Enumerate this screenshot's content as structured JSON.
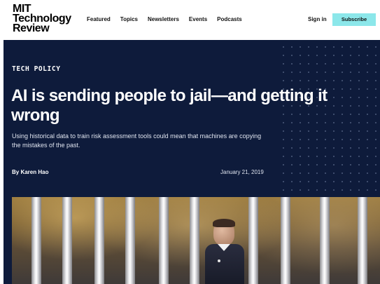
{
  "header": {
    "logo_line1": "MIT",
    "logo_line2": "Technology",
    "logo_line3": "Review",
    "nav": [
      "Featured",
      "Topics",
      "Newsletters",
      "Events",
      "Podcasts"
    ],
    "signin_label": "Sign in",
    "subscribe_label": "Subscribe",
    "subscribe_color": "#8ce7ea"
  },
  "hero": {
    "background_color": "#0e1b3b",
    "kicker": "TECH POLICY",
    "headline": "AI is sending people to jail—and getting it wrong",
    "dek": "Using historical data to train risk assessment tools could mean that machines are copying the mistakes of the past.",
    "byline": "By Karen Hao",
    "date": "January 21, 2019"
  },
  "photo": {
    "icon": "prison-bars-officer-photo"
  }
}
